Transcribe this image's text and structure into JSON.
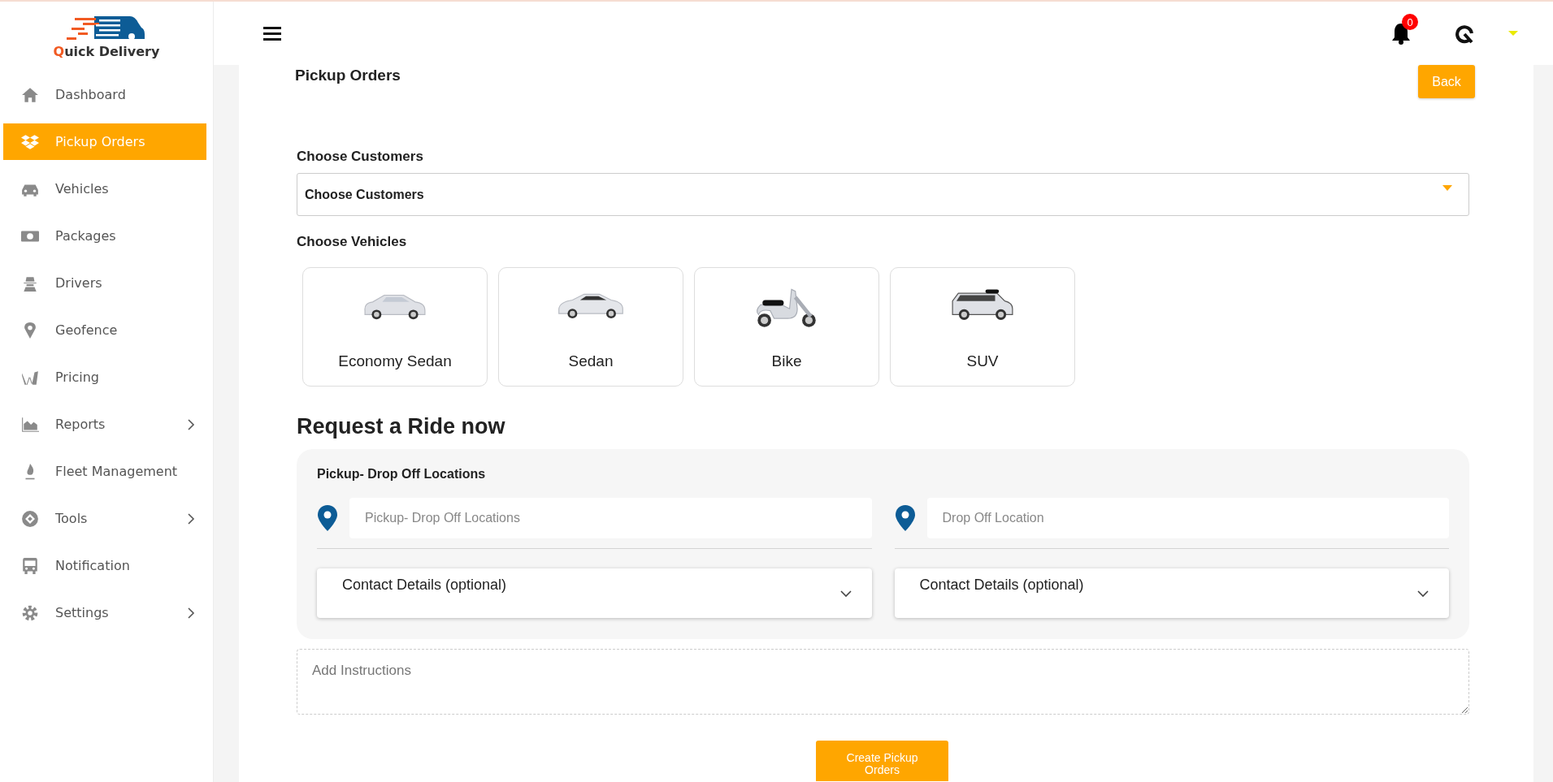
{
  "logo": {
    "text": "Quick Delivery"
  },
  "sidebar": {
    "items": [
      {
        "label": "Dashboard",
        "selected": false,
        "has_submenu": false
      },
      {
        "label": "Pickup Orders",
        "selected": true,
        "has_submenu": false
      },
      {
        "label": "Vehicles",
        "selected": false,
        "has_submenu": false
      },
      {
        "label": "Packages",
        "selected": false,
        "has_submenu": false
      },
      {
        "label": "Drivers",
        "selected": false,
        "has_submenu": false
      },
      {
        "label": "Geofence",
        "selected": false,
        "has_submenu": false
      },
      {
        "label": "Pricing",
        "selected": false,
        "has_submenu": false
      },
      {
        "label": "Reports",
        "selected": false,
        "has_submenu": true
      },
      {
        "label": "Fleet Management",
        "selected": false,
        "has_submenu": false
      },
      {
        "label": "Tools",
        "selected": false,
        "has_submenu": true
      },
      {
        "label": "Notification",
        "selected": false,
        "has_submenu": false
      },
      {
        "label": "Settings",
        "selected": false,
        "has_submenu": true
      }
    ]
  },
  "topbar": {
    "notification_count": "0"
  },
  "page": {
    "title": "Pickup Orders",
    "back_button": "Back"
  },
  "customers": {
    "label": "Choose Customers",
    "value": "Choose Customers"
  },
  "vehicles": {
    "label": "Choose Vehicles",
    "items": [
      {
        "label": "Economy Sedan"
      },
      {
        "label": "Sedan"
      },
      {
        "label": "Bike"
      },
      {
        "label": "SUV"
      }
    ]
  },
  "request": {
    "heading": "Request a Ride now",
    "section_label": "Pickup- Drop Off Locations",
    "locations": [
      {
        "placeholder": "Pickup- Drop Off Locations",
        "contact": "Contact Details (optional)",
        "expanded": false
      },
      {
        "placeholder": "Drop Off Location",
        "contact": "Contact Details (optional)",
        "expanded": false
      }
    ],
    "instructions_placeholder": "Add Instructions",
    "submit": "Create Pickup Orders"
  }
}
